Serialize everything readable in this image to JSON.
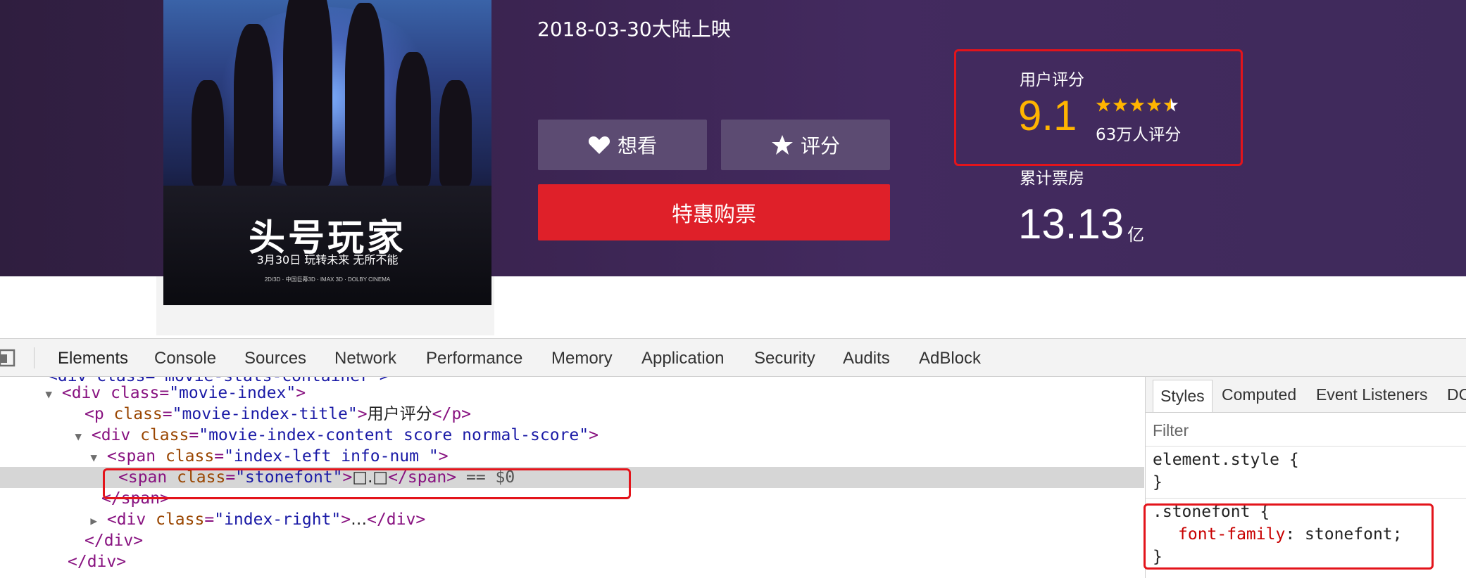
{
  "movie": {
    "poster": {
      "title": "头号玩家",
      "tagline": "3月30日 玩转未来 无所不能",
      "formats": "2D/3D · 中国巨幕3D · IMAX 3D · DOLBY CINEMA"
    },
    "release_info": "2018-03-30大陆上映",
    "buttons": {
      "want_label": "想看",
      "rate_label": "评分",
      "buy_label": "特惠购票"
    },
    "rating": {
      "label": "用户评分",
      "value": "9.1",
      "stars": 4.5,
      "votes": "63万人评分"
    },
    "box_office": {
      "label": "累计票房",
      "value": "13.13",
      "unit": "亿"
    }
  },
  "colors": {
    "score": "#ffb400",
    "buy_button": "#df2029",
    "secondary_button": "#5c4b72",
    "highlight_box": "#e3141b"
  },
  "devtools": {
    "tabs": [
      "Elements",
      "Console",
      "Sources",
      "Network",
      "Performance",
      "Memory",
      "Application",
      "Security",
      "Audits",
      "AdBlock"
    ],
    "active_tab": "Elements",
    "dom_lines": {
      "l0": "<div class=\"movie-stats-container\">",
      "l1_tag_open": "<div class=",
      "l1_val": "\"movie-index\"",
      "l2_class": "\"movie-index-title\"",
      "l2_text": "用户评分",
      "l3_val": "\"movie-index-content score normal-score\"",
      "l4_val": "\"index-left info-num \"",
      "l5_val": "\"stonefont\"",
      "l5_text": "□.□",
      "l5_suffix": "== $0",
      "l6": "</span>",
      "l7_val": "\"index-right\"",
      "l7_ellipsis": "…",
      "l8": "</div>",
      "l9": "</div>"
    },
    "styles_panel": {
      "tabs": [
        "Styles",
        "Computed",
        "Event Listeners",
        "DC"
      ],
      "filter_placeholder": "Filter",
      "element_style": "element.style {",
      "close_brace": "}",
      "rule_selector": ".stonefont {",
      "rule_property": "font-family",
      "rule_value": "stonefont;"
    }
  }
}
